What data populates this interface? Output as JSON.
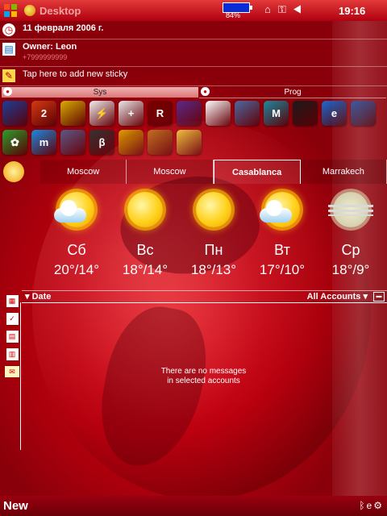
{
  "titlebar": {
    "start_icon": "windows-flag-icon",
    "title": "Desktop",
    "battery_percent": "84%",
    "battery_level": 0.84,
    "tray_icons": [
      "home-icon",
      "connectivity-icon",
      "speaker-icon"
    ],
    "time": "19:16"
  },
  "today": {
    "date": "11 февраля 2006 г.",
    "owner": "Owner: Leon",
    "owner_phone": "+7999999999",
    "sticky": "Tap here to add new sticky"
  },
  "launcher": {
    "tabs": [
      {
        "label": "Sys",
        "active": true
      },
      {
        "label": "Prog",
        "active": false
      }
    ],
    "row1": [
      {
        "icon": "colored-balls-icon",
        "text": "",
        "color": "#1a3d99"
      },
      {
        "icon": "badge-2-icon",
        "text": "2",
        "color": "#d63a10"
      },
      {
        "icon": "package-box-icon",
        "text": "",
        "color": "#d8b000"
      },
      {
        "icon": "flash-card-icon",
        "text": "⚡",
        "color": "#f0f0f0"
      },
      {
        "icon": "first-aid-icon",
        "text": "+",
        "color": "#eaeaea"
      },
      {
        "icon": "red-tool-icon",
        "text": "R",
        "color": "#7a0000"
      },
      {
        "icon": "winrar-books-icon",
        "text": "",
        "color": "#5a2a8a"
      },
      {
        "icon": "pdf-reader-icon",
        "text": "",
        "color": "#ffffff"
      },
      {
        "icon": "calculator-icon",
        "text": "",
        "color": "#4a6aa0"
      },
      {
        "icon": "metro-m-icon",
        "text": "M",
        "color": "#1a8aa0"
      },
      {
        "icon": "eclipse-orb-icon",
        "text": "",
        "color": "#1a1a1a"
      },
      {
        "icon": "internet-explorer-icon",
        "text": "e",
        "color": "#1a6ad0"
      },
      {
        "icon": "cube-app-icon",
        "text": "",
        "color": "#3a5aa0"
      }
    ],
    "row2": [
      {
        "icon": "icq-flower-icon",
        "text": "✿",
        "color": "#2aa02a"
      },
      {
        "icon": "messenger-m-icon",
        "text": "m",
        "color": "#1a8ae0"
      },
      {
        "icon": "orb-player-icon",
        "text": "",
        "color": "#5a5a8a"
      },
      {
        "icon": "beta-app-icon",
        "text": "β",
        "color": "#333333"
      },
      {
        "icon": "painter-tools-icon",
        "text": "",
        "color": "#e0a000"
      },
      {
        "icon": "camera-photo-icon",
        "text": "",
        "color": "#c07020"
      },
      {
        "icon": "folder-search-icon",
        "text": "",
        "color": "#f0c040"
      }
    ]
  },
  "weather": {
    "cities": [
      "Moscow",
      "Moscow",
      "Casablanca",
      "Marrakech"
    ],
    "active_city": 2,
    "days": [
      {
        "name": "Сб",
        "temp": "20°/14°",
        "icon": "sun-cloud-icon"
      },
      {
        "name": "Вс",
        "temp": "18°/14°",
        "icon": "sunny-icon"
      },
      {
        "name": "Пн",
        "temp": "18°/13°",
        "icon": "sunny-icon"
      },
      {
        "name": "Вт",
        "temp": "17°/10°",
        "icon": "sun-cloud-icon"
      },
      {
        "name": "Ср",
        "temp": "18°/9°",
        "icon": "haze-icon"
      }
    ]
  },
  "messaging": {
    "date_header": "Date",
    "accounts": "All Accounts",
    "empty_line1": "There are no messages",
    "empty_line2": "in selected accounts"
  },
  "bottombar": {
    "left_softkey": "New"
  }
}
